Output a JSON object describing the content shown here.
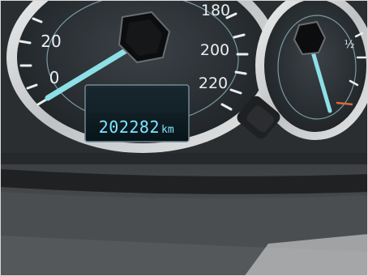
{
  "speedometer": {
    "labels": [
      "20",
      "0",
      "180",
      "200",
      "220"
    ]
  },
  "odometer": {
    "value": "202282",
    "unit": "km"
  },
  "secondary_gauge": {
    "label": "½"
  },
  "colors": {
    "bezel": "#c9c9c9",
    "dial": "#2a2f33",
    "needle": "#8de0e8",
    "odometer_display": "#0b1a22",
    "odometer_text": "#7fe6ff",
    "dashboard": "#3f4144"
  }
}
